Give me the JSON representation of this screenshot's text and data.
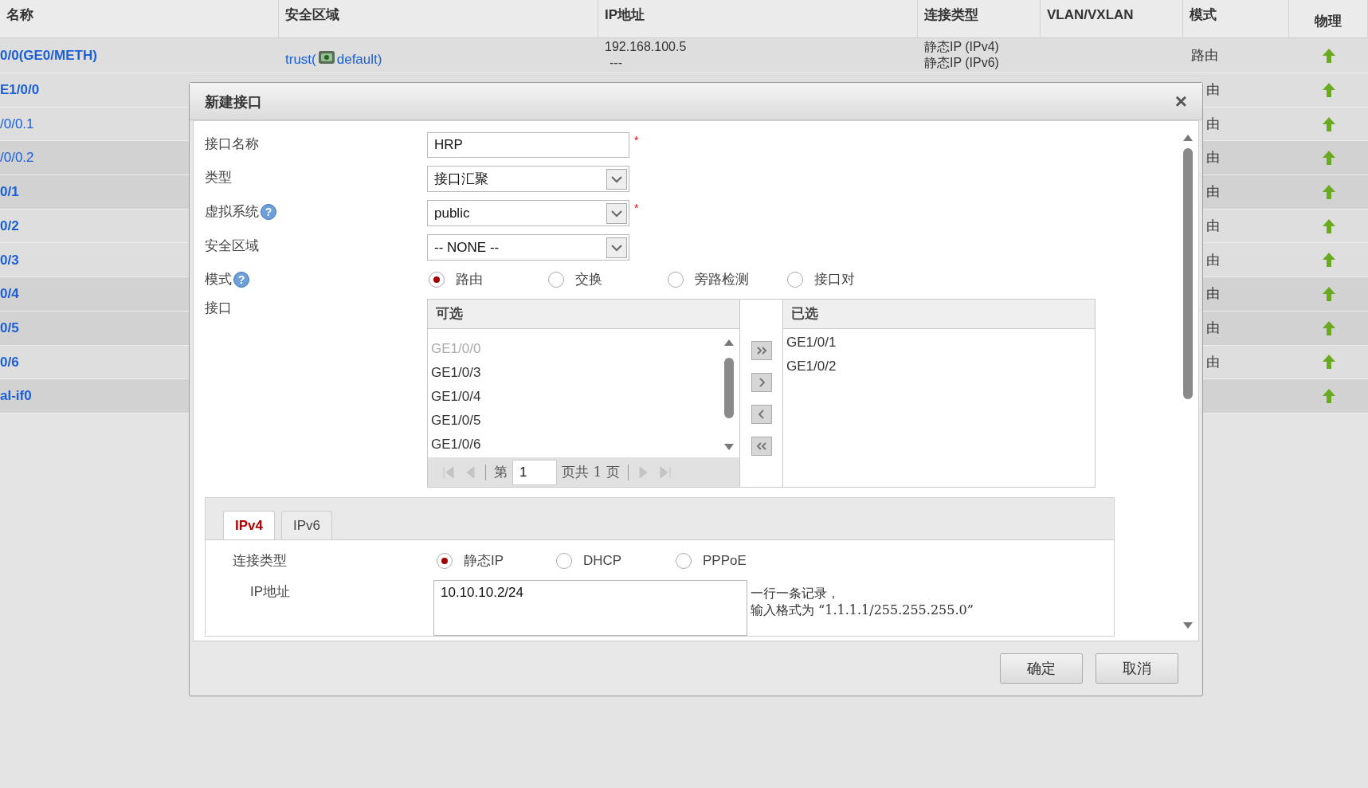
{
  "table": {
    "columns": [
      "名称",
      "安全区域",
      "IP地址",
      "连接类型",
      "VLAN/VXLAN",
      "模式",
      "物理"
    ],
    "rows": [
      {
        "name": "0/0(GE0/METH)",
        "bold": true,
        "zone_prefix": "trust(",
        "zone_suffix": "default)",
        "ip": [
          "192.168.100.5",
          "---"
        ],
        "connection": [
          "静态IP (IPv4)",
          "静态IP (IPv6)"
        ],
        "mode": "路由"
      },
      {
        "name": "E1/0/0",
        "bold": true,
        "mode": "由"
      },
      {
        "name": "/0/0.1",
        "bold": false,
        "mode": "由"
      },
      {
        "name": "/0/0.2",
        "bold": false,
        "mode": "由"
      },
      {
        "name": "0/1",
        "bold": true,
        "mode": "由"
      },
      {
        "name": "0/2",
        "bold": true,
        "mode": "由"
      },
      {
        "name": "0/3",
        "bold": true,
        "mode": "由"
      },
      {
        "name": "0/4",
        "bold": true,
        "mode": "由"
      },
      {
        "name": "0/5",
        "bold": true,
        "mode": "由"
      },
      {
        "name": "0/6",
        "bold": true,
        "mode": "由"
      },
      {
        "name": "al-if0",
        "bold": true
      }
    ]
  },
  "dialog": {
    "title": "新建接口",
    "close": "×",
    "fields": [
      {
        "kind": "text",
        "label": "接口名称",
        "value": "HRP",
        "required": "*"
      },
      {
        "kind": "select",
        "label": "类型",
        "value": "接口汇聚"
      },
      {
        "kind": "select",
        "label": "虚拟系统",
        "help": "?",
        "value": "public",
        "required": "*"
      },
      {
        "kind": "select",
        "label": "安全区域",
        "value": "-- NONE --"
      },
      {
        "kind": "radio",
        "label": "模式",
        "help": "?",
        "options": [
          {
            "label": "路由",
            "selected": true
          },
          {
            "label": "交换",
            "selected": false
          },
          {
            "label": "旁路检测",
            "selected": false
          },
          {
            "label": "接口对",
            "selected": false
          }
        ]
      },
      {
        "kind": "transfer",
        "label": "接口",
        "available_title": "可选",
        "available": [
          {
            "label": "GE1/0/0",
            "disabled": true
          },
          {
            "label": "GE1/0/3",
            "disabled": false
          },
          {
            "label": "GE1/0/4",
            "disabled": false
          },
          {
            "label": "GE1/0/5",
            "disabled": false
          },
          {
            "label": "GE1/0/6",
            "disabled": false
          }
        ],
        "selected_title": "已选",
        "chosen": [
          "GE1/0/1",
          "GE1/0/2"
        ],
        "pager": {
          "prefix": "第",
          "page": "1",
          "suffix": "页共 1 页"
        }
      }
    ],
    "address_tabs": [
      {
        "label": "IPv4",
        "selected": true
      },
      {
        "label": "IPv6",
        "selected": false
      }
    ],
    "connection": {
      "label": "连接类型",
      "options": [
        {
          "label": "静态IP",
          "selected": true
        },
        {
          "label": "DHCP",
          "selected": false
        },
        {
          "label": "PPPoE",
          "selected": false
        }
      ]
    },
    "ip": {
      "label": "IP地址",
      "value": "10.10.10.2/24",
      "hint": [
        "一行一条记录，",
        "输入格式为 “1.1.1.1/255.255.255.0”"
      ]
    },
    "buttons": [
      "确定",
      "取消"
    ]
  }
}
